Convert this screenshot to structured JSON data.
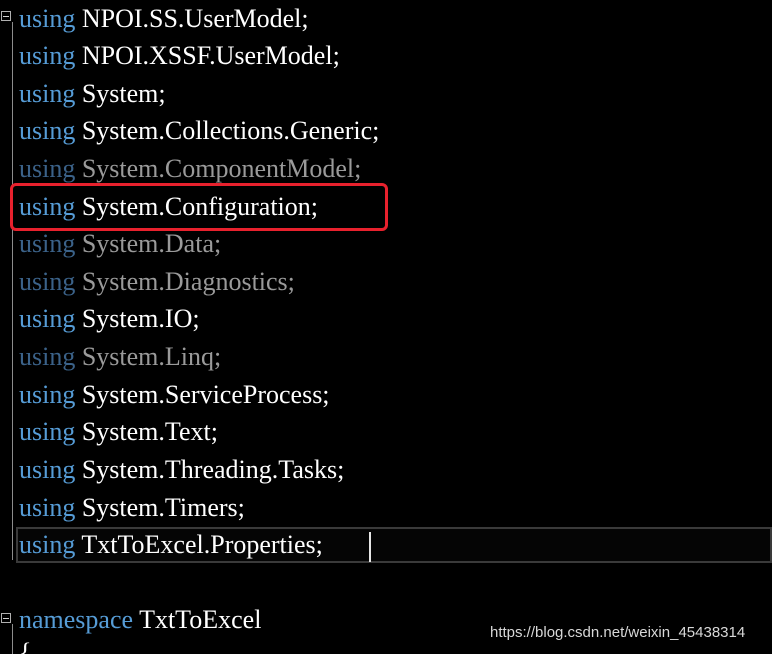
{
  "editor": {
    "using_lines": [
      {
        "keyword": "using",
        "namespace": "NPOI.SS.UserModel;",
        "dimmed": false
      },
      {
        "keyword": "using",
        "namespace": "NPOI.XSSF.UserModel;",
        "dimmed": false
      },
      {
        "keyword": "using",
        "namespace": "System;",
        "dimmed": false
      },
      {
        "keyword": "using",
        "namespace": "System.Collections.Generic;",
        "dimmed": false
      },
      {
        "keyword": "using",
        "namespace": "System.ComponentModel;",
        "dimmed": true
      },
      {
        "keyword": "using",
        "namespace": "System.Configuration;",
        "dimmed": false
      },
      {
        "keyword": "using",
        "namespace": "System.Data;",
        "dimmed": true
      },
      {
        "keyword": "using",
        "namespace": "System.Diagnostics;",
        "dimmed": true
      },
      {
        "keyword": "using",
        "namespace": "System.IO;",
        "dimmed": false
      },
      {
        "keyword": "using",
        "namespace": "System.Linq;",
        "dimmed": true
      },
      {
        "keyword": "using",
        "namespace": "System.ServiceProcess;",
        "dimmed": false
      },
      {
        "keyword": "using",
        "namespace": "System.Text;",
        "dimmed": false
      },
      {
        "keyword": "using",
        "namespace": "System.Threading.Tasks;",
        "dimmed": false
      },
      {
        "keyword": "using",
        "namespace": "System.Timers;",
        "dimmed": false
      },
      {
        "keyword": "using",
        "namespace": "TxtToExcel.Properties;",
        "dimmed": false
      }
    ],
    "namespace_line": {
      "keyword": "namespace",
      "name": "TxtToExcel"
    },
    "open_brace": "{"
  },
  "colors": {
    "background": "#000000",
    "keyword": "#569cd6",
    "identifier": "#ffffff",
    "highlight_box": "#e8212d"
  },
  "watermark": "https://blog.csdn.net/weixin_45438314"
}
